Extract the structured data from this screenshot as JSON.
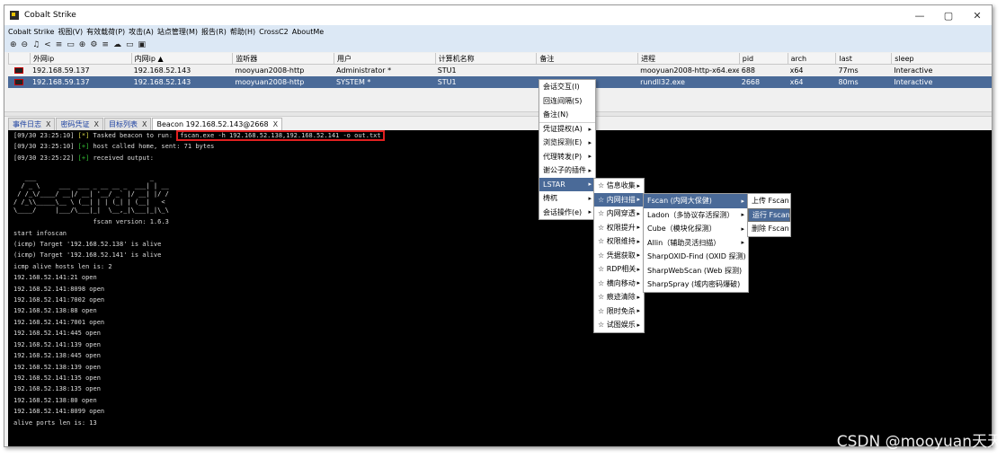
{
  "window": {
    "title": "Cobalt Strike",
    "controls": [
      "—",
      "▢",
      "✕"
    ]
  },
  "menubar": [
    "Cobalt Strike",
    "视图(V)",
    "有效载荷(P)",
    "攻击(A)",
    "站点管理(M)",
    "报告(R)",
    "帮助(H)",
    "CrossC2",
    "AboutMe"
  ],
  "toolbar": [
    "⊕",
    "⊖",
    "♫",
    "<",
    "≡",
    "▭",
    "⊕",
    "⚙",
    "≡",
    "☁",
    "▭",
    "▣"
  ],
  "table": {
    "headers": [
      "",
      "外网ip",
      "内网ip ▲",
      "监听器",
      "用户",
      "计算机名称",
      "备注",
      "进程",
      "pid",
      "arch",
      "last",
      "sleep"
    ],
    "rows": [
      [
        "",
        "192.168.59.137",
        "192.168.52.143",
        "mooyuan2008-http",
        "Administrator *",
        "STU1",
        "",
        "mooyuan2008-http-x64.exe",
        "688",
        "x64",
        "77ms",
        "Interactive"
      ],
      [
        "",
        "192.168.59.137",
        "192.168.52.143",
        "mooyuan2008-http",
        "SYSTEM *",
        "STU1",
        "",
        "rundll32.exe",
        "2668",
        "x64",
        "80ms",
        "Interactive"
      ]
    ]
  },
  "tabs": [
    {
      "label": "事件日志",
      "close": "X"
    },
    {
      "label": "密码凭证",
      "close": "X"
    },
    {
      "label": "目标列表",
      "close": "X"
    },
    {
      "label": "Beacon 192.168.52.143@2668",
      "close": "X"
    }
  ],
  "console": {
    "line1_prefix": "[09/30 23:25:10] ",
    "line1_mark": "[*]",
    "line1_text": " Tasked beacon to run: ",
    "line1_cmd": "fscan.exe -h 192.168.52.138,192.168.52.141 -o out.txt",
    "line2_prefix": "[09/30 23:25:10] ",
    "line2_mark": "[+]",
    "line2_text": " host called home, sent: 71 bytes",
    "line3_prefix": "[09/30 23:25:22] ",
    "line3_mark": "[+]",
    "line3_text": " received output:",
    "ascii_art": "   ___                              _\n  / _ \\     ___  ___ _ __ __ _  ___| | __\n / /_\\/____/ __|/ __| '__/ _` |/ __| |/ /\n/ /_\\\\_____\\__ \\ (__| | | (_| | (__|   <\n\\____/     |___/\\___|_|  \\__,_|\\___|_|\\_\\",
    "version": "                     fscan version: 1.6.3",
    "output": [
      "start infoscan",
      "(icmp) Target '192.168.52.138' is alive",
      "(icmp) Target '192.168.52.141' is alive",
      "icmp alive hosts len is: 2",
      "192.168.52.141:21 open",
      "192.168.52.141:8098 open",
      "192.168.52.141:7002 open",
      "192.168.52.138:88 open",
      "192.168.52.141:7001 open",
      "192.168.52.141:445 open",
      "192.168.52.141:139 open",
      "192.168.52.138:445 open",
      "192.168.52.138:139 open",
      "192.168.52.141:135 open",
      "192.168.52.138:135 open",
      "192.168.52.138:80 open",
      "192.168.52.141:8099 open",
      "alive ports len is: 13"
    ]
  },
  "context_menu": {
    "main": [
      "会话交互(I)",
      "回连间隔(S)",
      "备注(N)",
      "凭证提权(A)",
      "浏览探测(E)",
      "代理转发(P)",
      "谢公子的插件",
      "LSTAR",
      "梼杌",
      "会话操作(e)"
    ],
    "lstar": [
      "☆ 信息收集",
      "☆ 内网扫描",
      "☆ 内网穿透",
      "☆ 权限提升",
      "☆ 权限维持",
      "☆ 凭据获取",
      "☆ RDP相关",
      "☆ 横向移动",
      "☆ 痕迹清除",
      "☆ 限时免杀",
      "☆ 试图娱乐"
    ],
    "scan": [
      "Fscan (内网大保健)",
      "Ladon（多协议存活探测）",
      "Cube（模块化探测）",
      "Allin（辅助灵活扫描）",
      "SharpOXID-Find (OXID 探测)",
      "SharpWebScan (Web 探测)",
      "SharpSpray (域内密码爆破)"
    ],
    "fscan": [
      "上传 Fscan",
      "运行 Fscan",
      "删除 Fscan"
    ]
  },
  "watermark": "CSDN @mooyuan天天"
}
